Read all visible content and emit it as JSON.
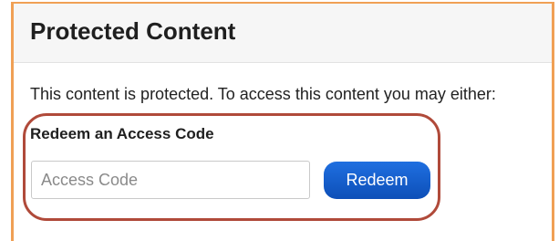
{
  "panel": {
    "title": "Protected Content",
    "intro": "This content is protected. To access this content you may either:"
  },
  "redeem": {
    "heading": "Redeem an Access Code",
    "input_placeholder": "Access Code",
    "input_value": "",
    "button_label": "Redeem"
  },
  "colors": {
    "frame_border": "#f0a055",
    "highlight_ring": "#b04a3a",
    "button": "#1560d0"
  }
}
